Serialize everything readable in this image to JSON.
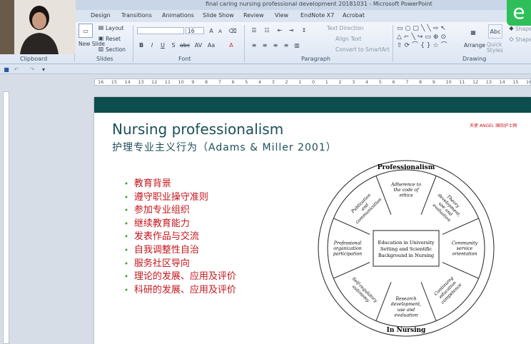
{
  "window": {
    "title": "final caring nursing professional development 20181031 - Microsoft PowerPoint"
  },
  "tabs": [
    "Design",
    "Transitions",
    "Animations",
    "Slide Show",
    "Review",
    "View",
    "EndNote X7",
    "Acrobat"
  ],
  "ribbon": {
    "clipboard_label": "Clipboard",
    "slides": {
      "new_slide": "New Slide",
      "layout": "Layout",
      "reset": "Reset",
      "section": "Section",
      "label": "Slides"
    },
    "font": {
      "size": "16",
      "label": "Font"
    },
    "paragraph": {
      "text_direction": "Text Direction",
      "align_text": "Align Text",
      "convert": "Convert to SmartArt",
      "label": "Paragraph"
    },
    "drawing": {
      "arrange": "Arrange",
      "quick_styles": "Quick Styles",
      "shape_fill": "Shape",
      "shape_outline": "Shape",
      "label": "Drawing"
    }
  },
  "ruler": {
    "ticks": [
      "16",
      "15",
      "14",
      "13",
      "12",
      "11",
      "10",
      "9",
      "8",
      "7",
      "6",
      "5",
      "4",
      "3",
      "2",
      "1",
      "0",
      "1",
      "2",
      "3",
      "4",
      "5",
      "6",
      "7",
      "8",
      "9",
      "10",
      "11",
      "12",
      "13",
      "14",
      "15",
      "16"
    ]
  },
  "slide": {
    "title": "Nursing professionalism",
    "subtitle": "护理专业主义行为（Adams & Miller 2001）",
    "logo_text": "天使 ANGEL  国际护士网",
    "bullets": [
      "教育背景",
      "遵守职业操守准则",
      "参加专业组织",
      "继续教育能力",
      "发表作品与交流",
      "自我调整性自治",
      "服务社区导向",
      "理论的发展、应用及评价",
      "科研的发展、应用及评价"
    ],
    "wheel": {
      "outer_top": "Professionalism",
      "outer_bottom": "In Nursing",
      "center": [
        "Education in University",
        "Setting and Scientific",
        "Background in Nursing"
      ],
      "spokes": [
        "Adherence to the code of ethics",
        "Theory development, use and evaluation",
        "Community service orientation",
        "Continuing education competence",
        "Research development, use and evaluation",
        "Self-regulatory autonomy",
        "Professional organization participation",
        "Publication and communication"
      ]
    }
  },
  "logo": {
    "letter": "e"
  }
}
